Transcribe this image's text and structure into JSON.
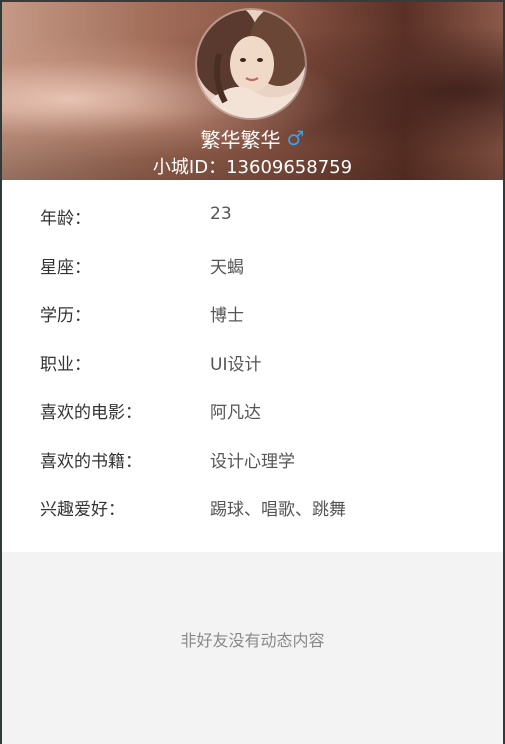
{
  "profile": {
    "name": "繁华繁华",
    "gender_symbol": "♂",
    "id_text": "小城ID：13609658759"
  },
  "details": [
    {
      "label": "年龄：",
      "value": "23"
    },
    {
      "label": "星座：",
      "value": "天蝎"
    },
    {
      "label": "学历：",
      "value": "博士"
    },
    {
      "label": "职业：",
      "value": "UI设计"
    },
    {
      "label": "喜欢的电影：",
      "value": "阿凡达"
    },
    {
      "label": "喜欢的书籍：",
      "value": "设计心理学"
    },
    {
      "label": "兴趣爱好：",
      "value": "踢球、唱歌、跳舞"
    }
  ],
  "feed": {
    "empty_message": "非好友没有动态内容"
  },
  "colors": {
    "gender_icon": "#3aa0e8",
    "info_background": "#ffffff",
    "page_background": "#f3f3f3",
    "empty_text": "#8a8a8a"
  },
  "icons": {
    "gender": "male-icon"
  }
}
